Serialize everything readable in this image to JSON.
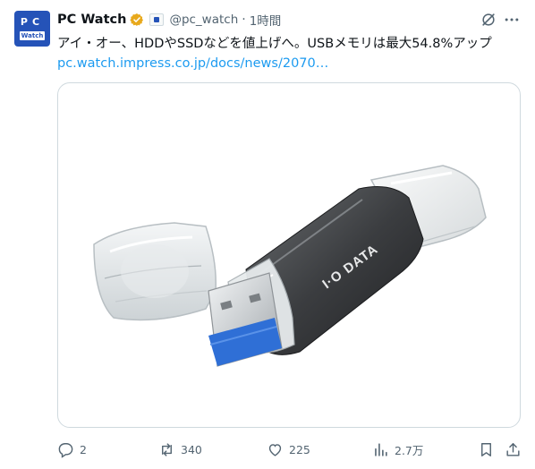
{
  "tweet": {
    "author_name": "PC Watch",
    "avatar_top": "PC",
    "avatar_bottom": "Watch",
    "handle": "@pc_watch",
    "separator": "·",
    "time": "1時間",
    "text": "アイ・オー、HDDやSSDなどを値上げへ。USBメモリは最大54.8%アップ",
    "link": "pc.watch.impress.co.jp/docs/news/2070…"
  },
  "media": {
    "device_brand": "I·O DATA"
  },
  "actions": {
    "replies": "2",
    "reposts": "340",
    "likes": "225",
    "views": "2.7万"
  },
  "colors": {
    "link": "#1d9bf0",
    "secondary_text": "#536471",
    "verified_badge": "#e8a91c",
    "avatar_bg": "#2553b8"
  },
  "icons": [
    "verified-badge-icon",
    "affiliate-badge-icon",
    "grok-icon",
    "more-icon",
    "reply-icon",
    "repost-icon",
    "like-icon",
    "views-icon",
    "bookmark-icon",
    "share-icon"
  ]
}
